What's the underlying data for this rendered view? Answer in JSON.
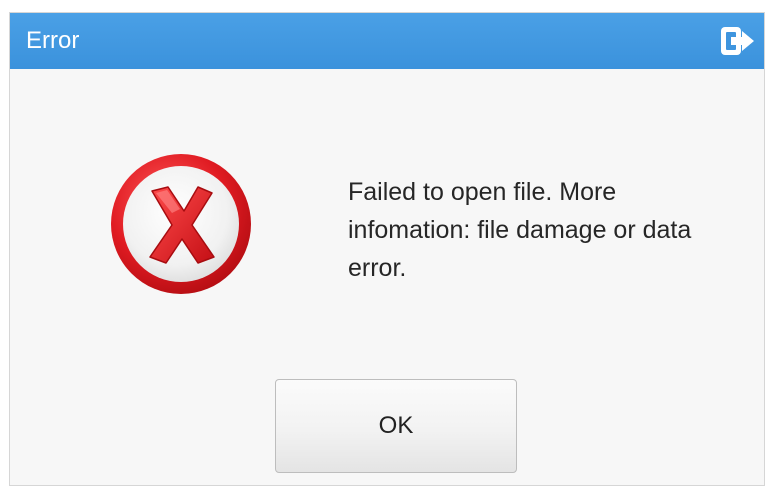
{
  "dialog": {
    "title": "Error",
    "exit_icon": "exit-door-arrow-icon",
    "error_icon": "error-x-circle-icon",
    "message": "Failed  to open file. More\ninfomation: file damage or data\nerror.",
    "ok_label": "OK"
  },
  "colors": {
    "titlebar": "#3b92dc",
    "title_text": "#ffffff",
    "dialog_bg": "#f7f7f7",
    "error_red": "#d9141a",
    "message_text": "#262626"
  }
}
